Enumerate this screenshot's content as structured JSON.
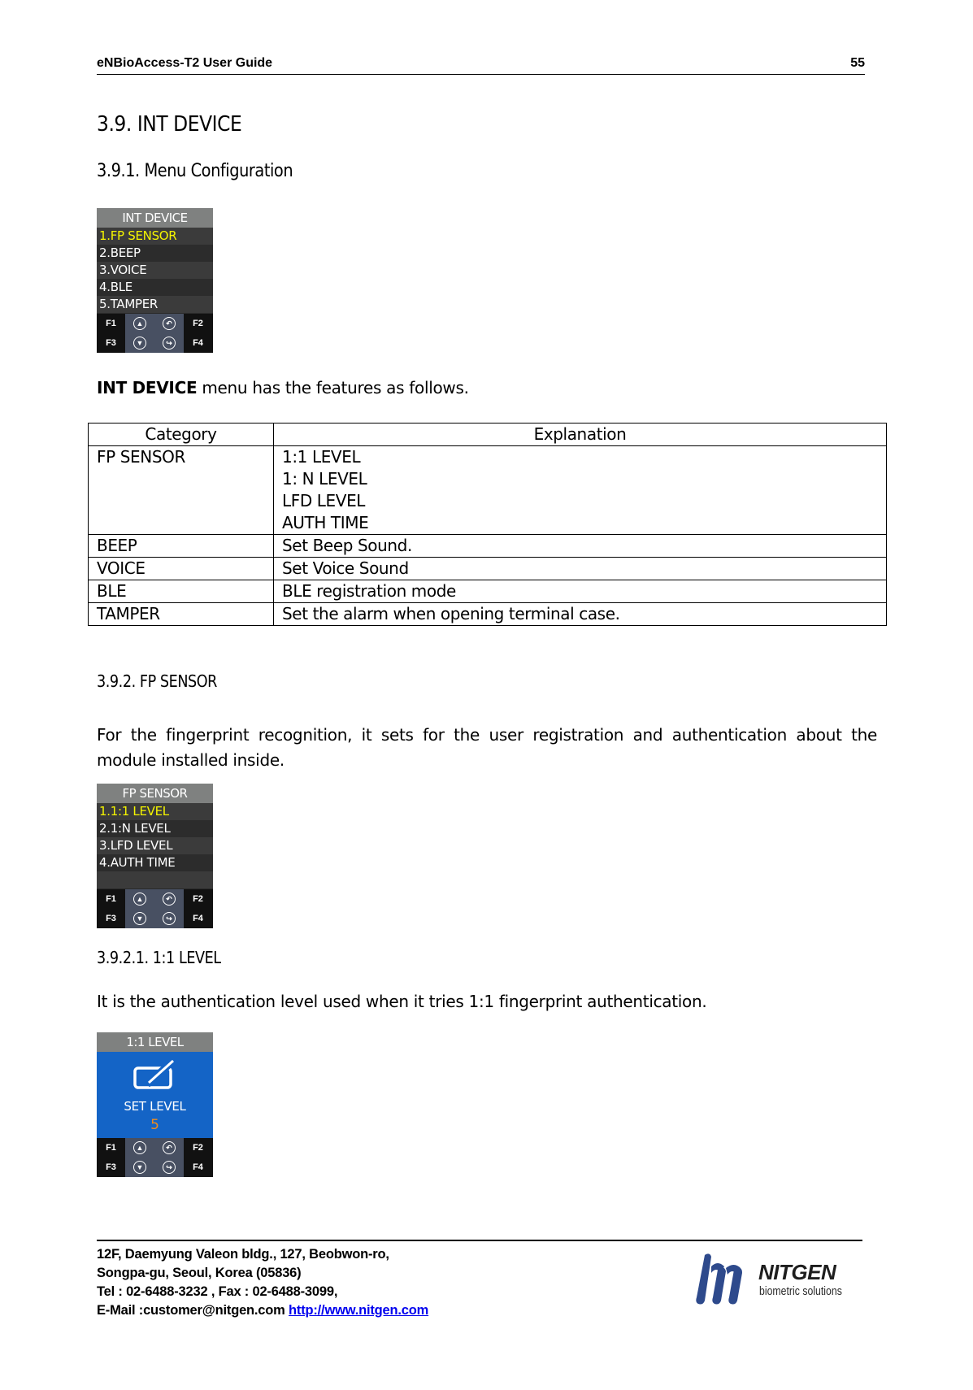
{
  "header": {
    "doc_title": "eNBioAccess-T2 User Guide",
    "page_number": "55"
  },
  "section": {
    "title": "3.9. INT DEVICE",
    "sub1_title": "3.9.1. Menu Configuration",
    "intro_bold": "INT DEVICE",
    "intro_rest": " menu has the features as follows.",
    "sub2_title": "3.9.2. FP SENSOR",
    "sub2_text": "For the fingerprint recognition, it sets for the user registration and authentication about the module installed inside.",
    "sub21_title": "3.9.2.1.   1:1 LEVEL",
    "sub21_text": "It is the authentication level used when it tries 1:1 fingerprint authentication."
  },
  "screens": {
    "int_device": {
      "title": "INT DEVICE",
      "items": [
        "1.FP SENSOR",
        "2.BEEP",
        "3.VOICE",
        "4.BLE",
        "5.TAMPER"
      ],
      "selected_index": 0
    },
    "fp_sensor": {
      "title": "FP SENSOR",
      "items": [
        "1.1:1 LEVEL",
        "2.1:N LEVEL",
        "3.LFD LEVEL",
        "4.AUTH TIME"
      ],
      "selected_index": 0
    },
    "level_1_1": {
      "title": "1:1 LEVEL",
      "label": "SET LEVEL",
      "value": "5",
      "value_color": "#f08c1e",
      "bg_color": "#1464c6"
    },
    "keys": {
      "f1": "F1",
      "f2": "F2",
      "f3": "F3",
      "f4": "F4",
      "up_icon": "▲",
      "down_icon": "▼",
      "back_icon": "↶",
      "enter_icon": "↪"
    }
  },
  "table": {
    "headers": [
      "Category",
      "Explanation"
    ],
    "rows": [
      {
        "category": "FP SENSOR",
        "explanation": [
          "1:1 LEVEL",
          "1: N LEVEL",
          "LFD LEVEL",
          "AUTH TIME"
        ]
      },
      {
        "category": "BEEP",
        "explanation": [
          "Set Beep Sound."
        ]
      },
      {
        "category": "VOICE",
        "explanation": [
          "Set Voice Sound"
        ]
      },
      {
        "category": "BLE",
        "explanation": [
          "BLE registration mode"
        ]
      },
      {
        "category": "TAMPER",
        "explanation": [
          "Set the alarm when opening terminal case."
        ]
      }
    ]
  },
  "footer": {
    "address1": "12F, Daemyung Valeon bldg., 127, Beobwon-ro,",
    "address2": "Songpa-gu, Seoul, Korea (05836)",
    "phone": "Tel : 02-6488-3232 , Fax : 02-6488-3099,",
    "email": "E-Mail :customer@nitgen.com ",
    "url": "http://www.nitgen.com",
    "logo_brand": "NITGEN",
    "logo_tagline": "biometric solutions",
    "logo_color": "#2e4a8c"
  }
}
